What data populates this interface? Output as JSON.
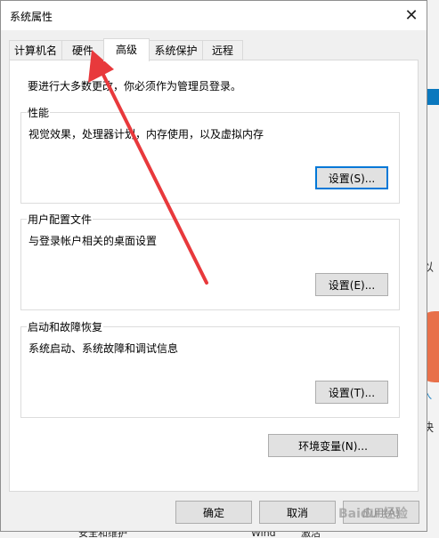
{
  "dialog": {
    "title": "系统属性",
    "close_glyph": "✕"
  },
  "tabs": [
    {
      "label": "计算机名",
      "active": false
    },
    {
      "label": "硬件",
      "active": false
    },
    {
      "label": "高级",
      "active": true
    },
    {
      "label": "系统保护",
      "active": false
    },
    {
      "label": "远程",
      "active": false
    }
  ],
  "advanced": {
    "admin_notice": "要进行大多数更改，你必须作为管理员登录。",
    "performance": {
      "label": "性能",
      "description": "视觉效果，处理器计划，内存使用，以及虚拟内存",
      "button": "设置(S)..."
    },
    "user_profiles": {
      "label": "用户配置文件",
      "description": "与登录帐户相关的桌面设置",
      "button": "设置(E)..."
    },
    "startup_recovery": {
      "label": "启动和故障恢复",
      "description": "系统启动、系统故障和调试信息",
      "button": "设置(T)..."
    },
    "env_vars_button": "环境变量(N)..."
  },
  "footer": {
    "ok": "确定",
    "cancel": "取消",
    "apply": "应用(A)"
  },
  "background": {
    "right_snippets": [
      "以",
      "入",
      "快"
    ],
    "bottom_snippets": [
      "安全和维护",
      "Wind",
      "激活"
    ]
  },
  "overlay": {
    "watermark": "Baidu 经验",
    "arrow_color": "#e8393c",
    "accent_color": "#0078d7"
  }
}
